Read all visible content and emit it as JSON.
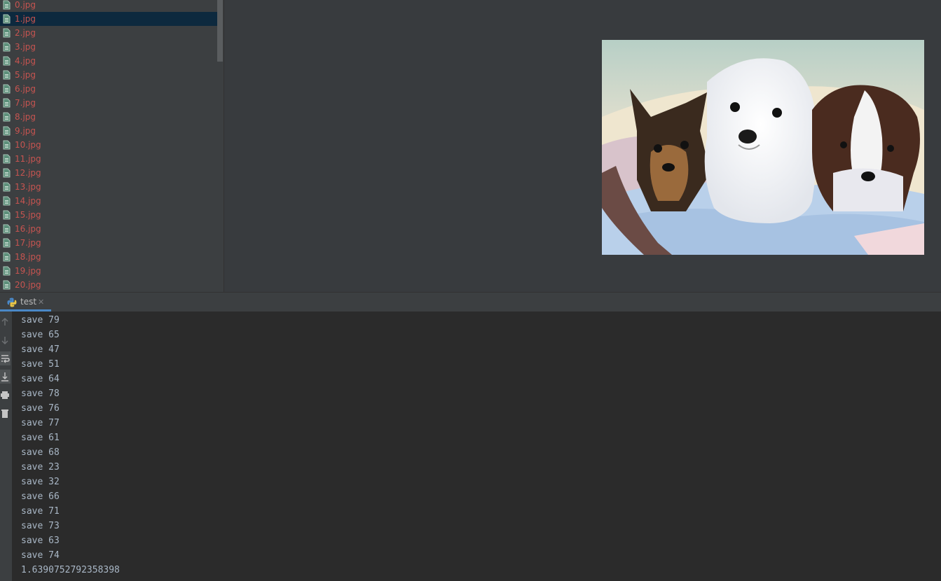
{
  "project_tree": {
    "files": [
      "0.jpg",
      "1.jpg",
      "2.jpg",
      "3.jpg",
      "4.jpg",
      "5.jpg",
      "6.jpg",
      "7.jpg",
      "8.jpg",
      "9.jpg",
      "10.jpg",
      "11.jpg",
      "12.jpg",
      "13.jpg",
      "14.jpg",
      "15.jpg",
      "16.jpg",
      "17.jpg",
      "18.jpg",
      "19.jpg",
      "20.jpg"
    ],
    "selected": "1.jpg",
    "icon": "image-file-icon",
    "file_color": "#c75450"
  },
  "editor": {
    "preview": "puppies-photo"
  },
  "run_panel": {
    "tab_label": "test",
    "tab_icon": "python-icon",
    "toolbar": [
      "up-arrow-icon",
      "down-arrow-icon",
      "soft-wrap-icon",
      "scroll-to-end-icon",
      "print-icon",
      "trash-icon"
    ]
  },
  "console": {
    "lines": [
      "save 79",
      "save 65",
      "save 47",
      "save 51",
      "save 64",
      "save 78",
      "save 76",
      "save 77",
      "save 61",
      "save 68",
      "save 23",
      "save 32",
      "save 66",
      "save 71",
      "save 73",
      "save 63",
      "save 74",
      "1.6390752792358398"
    ]
  }
}
